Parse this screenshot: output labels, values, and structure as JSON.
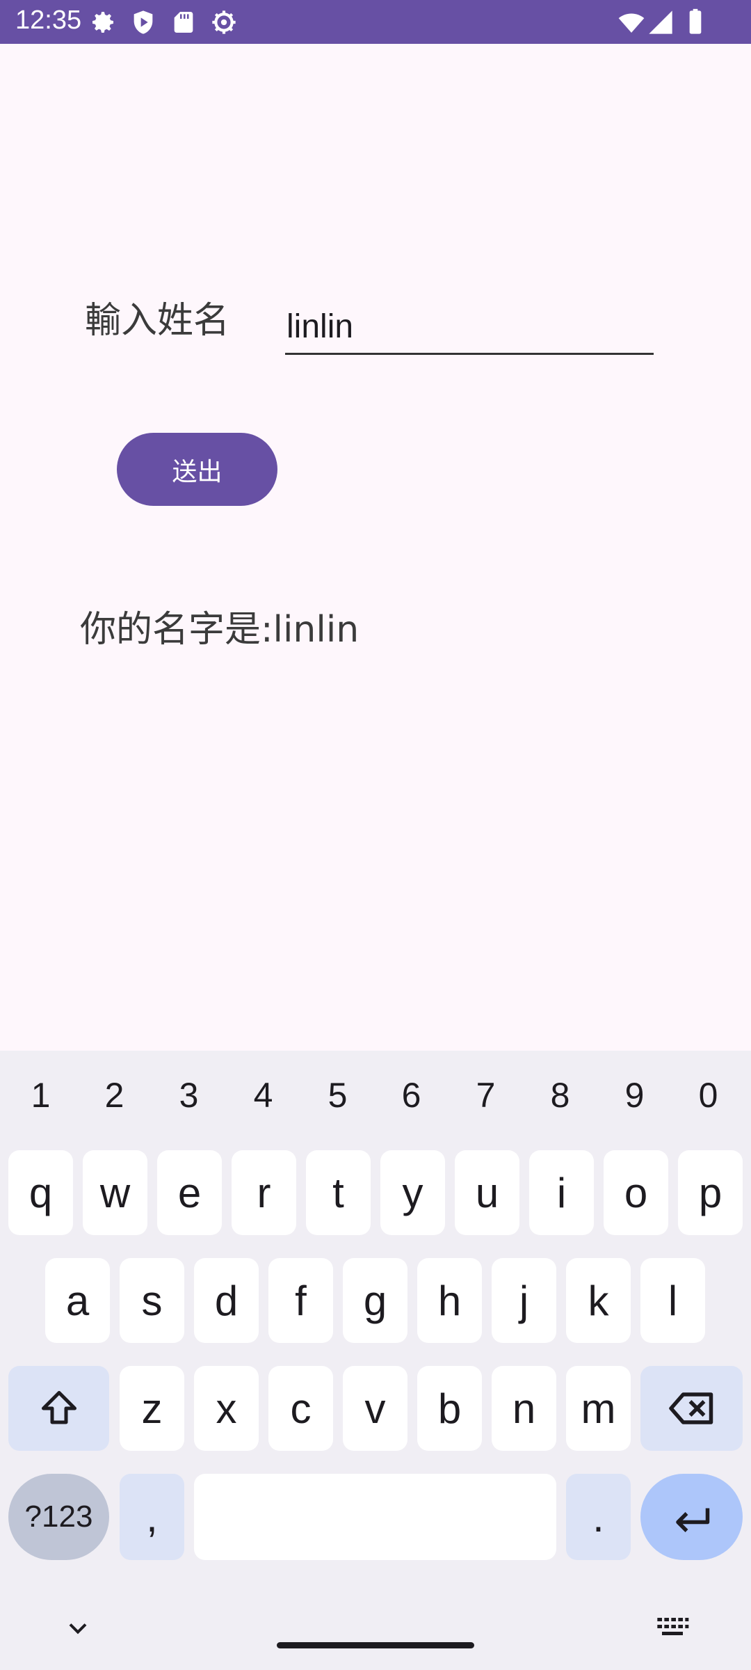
{
  "status_bar": {
    "time": "12:35",
    "left_icons": [
      "settings-icon",
      "play-protect-icon",
      "sd-card-icon",
      "settings-icon-2"
    ],
    "right_icons": [
      "wifi-icon",
      "signal-icon",
      "battery-icon"
    ],
    "background": "#6750A4"
  },
  "form": {
    "name_label": "輸入姓名",
    "name_value": "linlin",
    "submit_label": "送出",
    "result_text": "你的名字是:linlin"
  },
  "keyboard": {
    "number_row": [
      "1",
      "2",
      "3",
      "4",
      "5",
      "6",
      "7",
      "8",
      "9",
      "0"
    ],
    "row1": [
      "q",
      "w",
      "e",
      "r",
      "t",
      "y",
      "u",
      "i",
      "o",
      "p"
    ],
    "row2": [
      "a",
      "s",
      "d",
      "f",
      "g",
      "h",
      "j",
      "k",
      "l"
    ],
    "row3": [
      "z",
      "x",
      "c",
      "v",
      "b",
      "n",
      "m"
    ],
    "symbols_label": "?123",
    "comma_label": ",",
    "period_label": "."
  },
  "colors": {
    "primary": "#6750A4",
    "background": "#FEF7FC",
    "keyboard_bg": "#F0EEF4",
    "modifier_key": "#DCE3F6",
    "enter_key": "#ADC6FA"
  }
}
